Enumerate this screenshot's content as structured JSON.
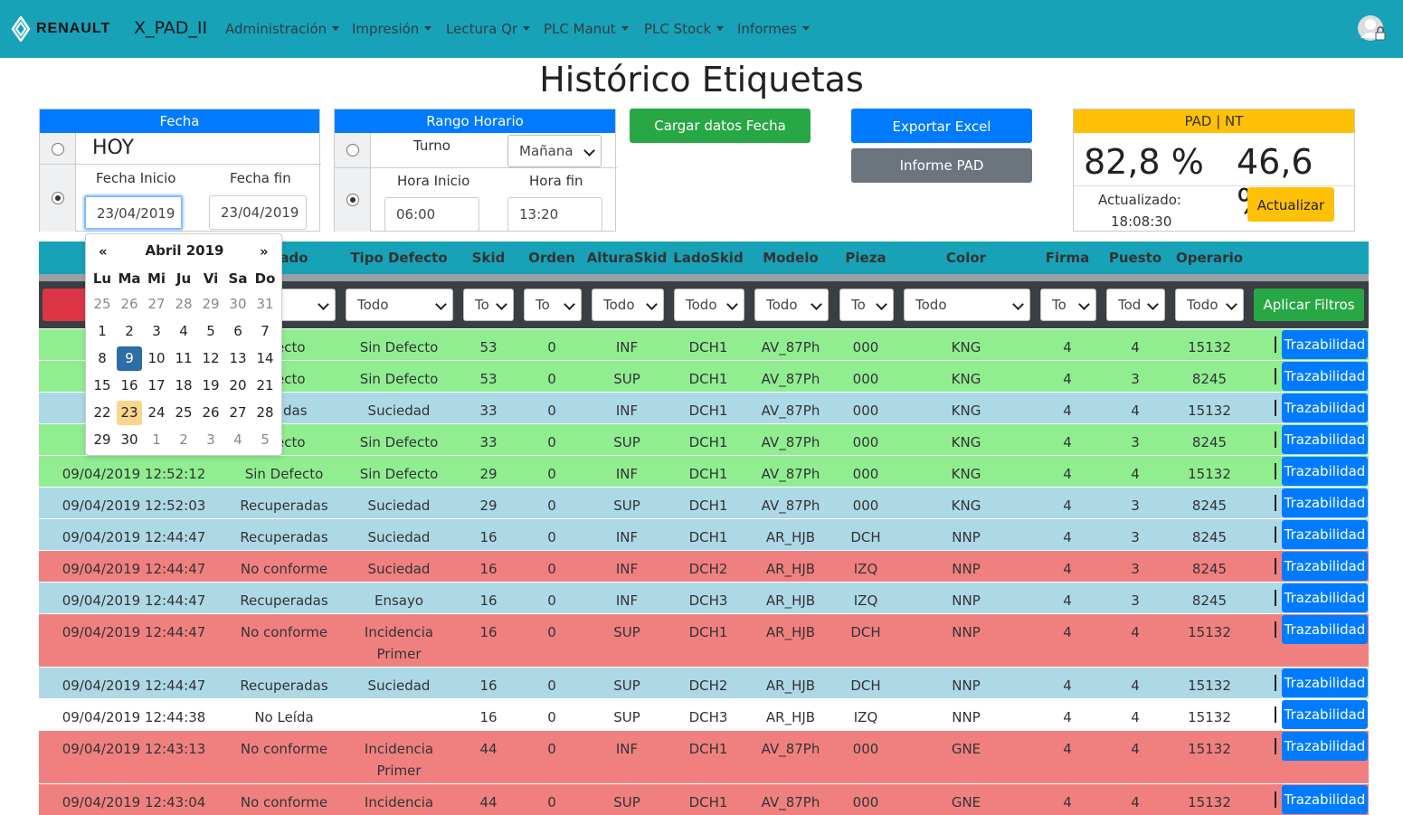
{
  "nav": {
    "brand": "RENAULT",
    "app_title": "X_PAD_II",
    "menus": [
      "Administración",
      "Impresión",
      "Lectura Qr",
      "PLC Manut",
      "PLC Stock",
      "Informes"
    ]
  },
  "page_title": "Histórico Etiquetas",
  "fecha": {
    "header": "Fecha",
    "hoy": "HOY",
    "inicio_label": "Fecha Inicio",
    "fin_label": "Fecha fin",
    "inicio_value": "23/04/2019",
    "fin_value": "23/04/2019"
  },
  "rango": {
    "header": "Rango Horario",
    "turno_label": "Turno",
    "turno_value": "Mañana",
    "inicio_label": "Hora Inicio",
    "fin_label": "Hora fin",
    "inicio_value": "06:00",
    "fin_value": "13:20"
  },
  "buttons": {
    "cargar": "Cargar datos Fecha",
    "exportar": "Exportar Excel",
    "informe": "Informe PAD",
    "actualizar": "Actualizar",
    "aplicar": "Aplicar Filtros"
  },
  "pad": {
    "header": "PAD | NT",
    "pad_value": "82,8 %",
    "nt_value": "46,6 %",
    "updated_label": "Actualizado:",
    "updated_time": "18:08:30"
  },
  "table": {
    "headers": [
      "ado",
      "Tipo Defecto",
      "Skid",
      "Orden",
      "AlturaSkid",
      "LadoSkid",
      "Modelo",
      "Pieza",
      "Color",
      "Firma",
      "Puesto",
      "Operario"
    ],
    "filters": [
      "",
      "Todo",
      "To",
      "To",
      "Todo",
      "Todo",
      "Todo",
      "To",
      "Todo",
      "To",
      "Tod",
      "Todo"
    ],
    "row_button": "Trazabilidad",
    "rows": [
      {
        "color": "#90ee90",
        "fecha": "09/",
        "estado": "efecto",
        "tipo": "Sin Defecto",
        "skid": "53",
        "orden": "0",
        "altura": "INF",
        "lado": "DCH1",
        "modelo": "AV_87Ph",
        "pieza": "000",
        "col": "KNG",
        "firma": "4",
        "puesto": "4",
        "operario": "15132"
      },
      {
        "color": "#90ee90",
        "fecha": "09/",
        "estado": "efecto",
        "tipo": "Sin Defecto",
        "skid": "53",
        "orden": "0",
        "altura": "SUP",
        "lado": "DCH1",
        "modelo": "AV_87Ph",
        "pieza": "000",
        "col": "KNG",
        "firma": "4",
        "puesto": "3",
        "operario": "8245"
      },
      {
        "color": "#add8e6",
        "fecha": "09/",
        "estado": "eradas",
        "tipo": "Suciedad",
        "skid": "33",
        "orden": "0",
        "altura": "INF",
        "lado": "DCH1",
        "modelo": "AV_87Ph",
        "pieza": "000",
        "col": "KNG",
        "firma": "4",
        "puesto": "4",
        "operario": "15132"
      },
      {
        "color": "#90ee90",
        "fecha": "09/",
        "estado": "efecto",
        "tipo": "Sin Defecto",
        "skid": "33",
        "orden": "0",
        "altura": "SUP",
        "lado": "DCH1",
        "modelo": "AV_87Ph",
        "pieza": "000",
        "col": "KNG",
        "firma": "4",
        "puesto": "3",
        "operario": "8245"
      },
      {
        "color": "#90ee90",
        "fecha": "09/04/2019 12:52:12",
        "estado": "Sin Defecto",
        "tipo": "Sin Defecto",
        "skid": "29",
        "orden": "0",
        "altura": "INF",
        "lado": "DCH1",
        "modelo": "AV_87Ph",
        "pieza": "000",
        "col": "KNG",
        "firma": "4",
        "puesto": "4",
        "operario": "15132"
      },
      {
        "color": "#add8e6",
        "fecha": "09/04/2019 12:52:03",
        "estado": "Recuperadas",
        "tipo": "Suciedad",
        "skid": "29",
        "orden": "0",
        "altura": "SUP",
        "lado": "DCH1",
        "modelo": "AV_87Ph",
        "pieza": "000",
        "col": "KNG",
        "firma": "4",
        "puesto": "3",
        "operario": "8245"
      },
      {
        "color": "#add8e6",
        "fecha": "09/04/2019 12:44:47",
        "estado": "Recuperadas",
        "tipo": "Suciedad",
        "skid": "16",
        "orden": "0",
        "altura": "INF",
        "lado": "DCH1",
        "modelo": "AR_HJB",
        "pieza": "DCH",
        "col": "NNP",
        "firma": "4",
        "puesto": "3",
        "operario": "8245"
      },
      {
        "color": "#f08080",
        "fecha": "09/04/2019 12:44:47",
        "estado": "No conforme",
        "tipo": "Suciedad",
        "skid": "16",
        "orden": "0",
        "altura": "INF",
        "lado": "DCH2",
        "modelo": "AR_HJB",
        "pieza": "IZQ",
        "col": "NNP",
        "firma": "4",
        "puesto": "3",
        "operario": "8245"
      },
      {
        "color": "#add8e6",
        "fecha": "09/04/2019 12:44:47",
        "estado": "Recuperadas",
        "tipo": "Ensayo",
        "skid": "16",
        "orden": "0",
        "altura": "INF",
        "lado": "DCH3",
        "modelo": "AR_HJB",
        "pieza": "IZQ",
        "col": "NNP",
        "firma": "4",
        "puesto": "3",
        "operario": "8245"
      },
      {
        "color": "#f08080",
        "fecha": "09/04/2019 12:44:47",
        "estado": "No conforme",
        "tipo": "Incidencia\nPrimer",
        "skid": "16",
        "orden": "0",
        "altura": "SUP",
        "lado": "DCH1",
        "modelo": "AR_HJB",
        "pieza": "DCH",
        "col": "NNP",
        "firma": "4",
        "puesto": "4",
        "operario": "15132"
      },
      {
        "color": "#add8e6",
        "fecha": "09/04/2019 12:44:47",
        "estado": "Recuperadas",
        "tipo": "Suciedad",
        "skid": "16",
        "orden": "0",
        "altura": "SUP",
        "lado": "DCH2",
        "modelo": "AR_HJB",
        "pieza": "DCH",
        "col": "NNP",
        "firma": "4",
        "puesto": "4",
        "operario": "15132"
      },
      {
        "color": "#ffffff",
        "fecha": "09/04/2019 12:44:38",
        "estado": "No Leída",
        "tipo": "",
        "skid": "16",
        "orden": "0",
        "altura": "SUP",
        "lado": "DCH3",
        "modelo": "AR_HJB",
        "pieza": "IZQ",
        "col": "NNP",
        "firma": "4",
        "puesto": "4",
        "operario": "15132"
      },
      {
        "color": "#f08080",
        "fecha": "09/04/2019 12:43:13",
        "estado": "No conforme",
        "tipo": "Incidencia\nPrimer",
        "skid": "44",
        "orden": "0",
        "altura": "INF",
        "lado": "DCH1",
        "modelo": "AV_87Ph",
        "pieza": "000",
        "col": "GNE",
        "firma": "4",
        "puesto": "4",
        "operario": "15132"
      },
      {
        "color": "#f08080",
        "fecha": "09/04/2019 12:43:04",
        "estado": "No conforme",
        "tipo": "Incidencia",
        "skid": "44",
        "orden": "0",
        "altura": "SUP",
        "lado": "DCH1",
        "modelo": "AV_87Ph",
        "pieza": "000",
        "col": "GNE",
        "firma": "4",
        "puesto": "4",
        "operario": "15132"
      }
    ]
  },
  "calendar": {
    "prev": "«",
    "next": "»",
    "title": "Abril 2019",
    "dow": [
      "Lu",
      "Ma",
      "Mi",
      "Ju",
      "Vi",
      "Sa",
      "Do"
    ],
    "weeks": [
      [
        "25",
        "26",
        "27",
        "28",
        "29",
        "30",
        "31"
      ],
      [
        "1",
        "2",
        "3",
        "4",
        "5",
        "6",
        "7"
      ],
      [
        "8",
        "9",
        "10",
        "11",
        "12",
        "13",
        "14"
      ],
      [
        "15",
        "16",
        "17",
        "18",
        "19",
        "20",
        "21"
      ],
      [
        "22",
        "23",
        "24",
        "25",
        "26",
        "27",
        "28"
      ],
      [
        "29",
        "30",
        "1",
        "2",
        "3",
        "4",
        "5"
      ]
    ],
    "muted": [
      [
        0,
        0
      ],
      [
        0,
        1
      ],
      [
        0,
        2
      ],
      [
        0,
        3
      ],
      [
        0,
        4
      ],
      [
        0,
        5
      ],
      [
        0,
        6
      ],
      [
        5,
        2
      ],
      [
        5,
        3
      ],
      [
        5,
        4
      ],
      [
        5,
        5
      ],
      [
        5,
        6
      ]
    ],
    "selected": [
      2,
      1
    ],
    "today": [
      4,
      1
    ]
  }
}
